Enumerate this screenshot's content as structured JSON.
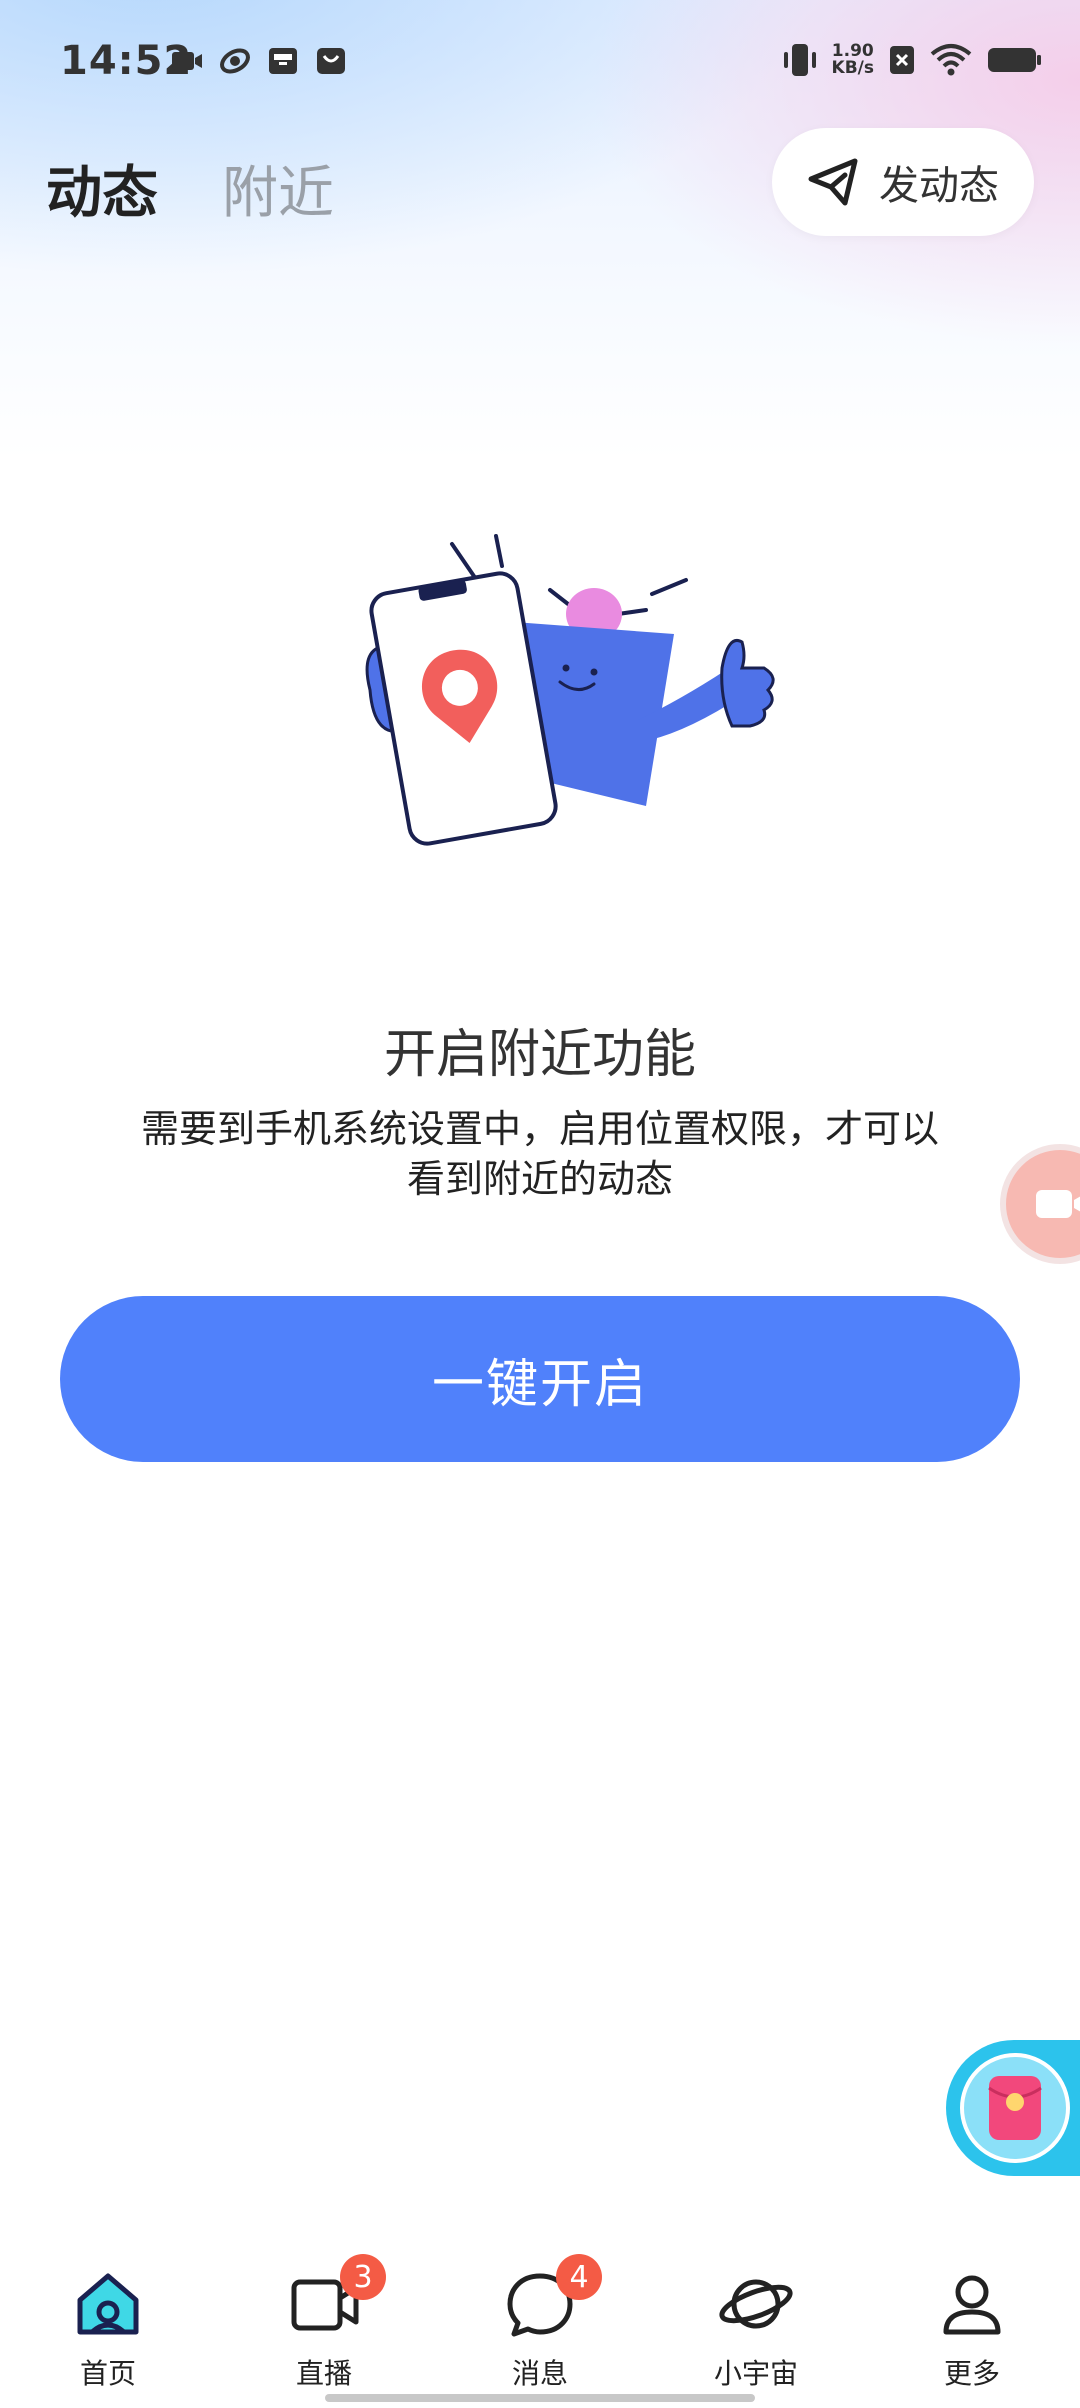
{
  "status_bar": {
    "time": "14:52",
    "net_speed_value": "1.90",
    "net_speed_unit": "KB/s",
    "app_icons": [
      "video-call-icon",
      "game-icon",
      "inbox-icon",
      "shopping-bag-icon"
    ],
    "right_icons": [
      "vibrate-icon",
      "network-speed",
      "no-sim-icon",
      "wifi-icon",
      "battery-icon"
    ]
  },
  "header": {
    "tabs": [
      {
        "label": "动态",
        "active": true
      },
      {
        "label": "附近",
        "active": false
      }
    ],
    "post_button": {
      "label": "发动态",
      "icon": "send-icon"
    }
  },
  "empty_state": {
    "illustration": "location-phone-illustration",
    "title": "开启附近功能",
    "description": "需要到手机系统设置中，启用位置权限，才可以看到附近的动态",
    "button_label": "一键开启"
  },
  "floating": {
    "video_widget": "video-camera-icon",
    "red_packet_widget": "red-packet-icon"
  },
  "bottom_nav": {
    "items": [
      {
        "label": "首页",
        "icon": "home-icon",
        "active": true
      },
      {
        "label": "直播",
        "icon": "live-video-icon",
        "badge": "3"
      },
      {
        "label": "消息",
        "icon": "message-icon",
        "badge": "4"
      },
      {
        "label": "小宇宙",
        "icon": "planet-icon"
      },
      {
        "label": "更多",
        "icon": "profile-icon"
      }
    ]
  },
  "colors": {
    "accent": "#5081fb",
    "badge": "#f45b45",
    "illustration_blue": "#4f72e8",
    "pin_red": "#f25f5c",
    "hat_pink": "#e98be0"
  }
}
